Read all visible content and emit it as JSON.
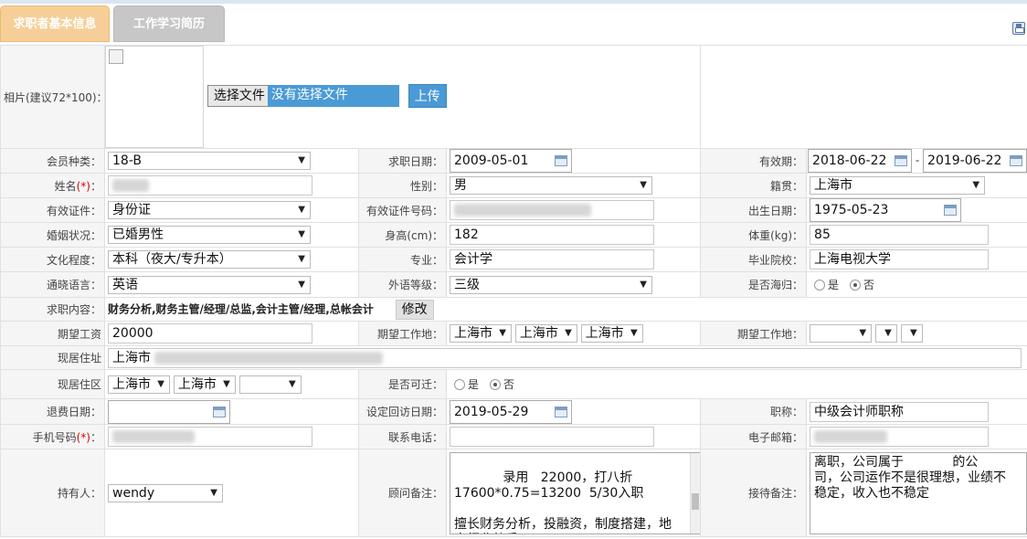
{
  "tabs": [
    {
      "label": "求职者基本信息"
    },
    {
      "label": "工作学习简历"
    }
  ],
  "photo": {
    "label": "相片(建议72*100)：",
    "file_button": "选择文件",
    "file_text": "没有选择文件",
    "upload_button": "上传"
  },
  "member_type": {
    "label": "会员种类：",
    "value": "18-B"
  },
  "apply_date": {
    "label": "求职日期：",
    "value": "2009-05-01"
  },
  "valid_period": {
    "label": "有效期：",
    "start": "2018-06-22",
    "sep": "-",
    "end": "2019-06-22"
  },
  "name": {
    "label": "姓名",
    "req": "(*)",
    "colon": "："
  },
  "gender": {
    "label": "性别：",
    "value": "男"
  },
  "native": {
    "label": "籍贯：",
    "value": "上海市"
  },
  "id_type": {
    "label": "有效证件：",
    "value": "身份证"
  },
  "id_number": {
    "label": "有效证件号码："
  },
  "birth": {
    "label": "出生日期：",
    "value": "1975-05-23"
  },
  "marital": {
    "label": "婚姻状况：",
    "value": "已婚男性"
  },
  "height": {
    "label": "身高(cm)：",
    "value": "182"
  },
  "weight": {
    "label": "体重(kg)：",
    "value": "85"
  },
  "education": {
    "label": "文化程度：",
    "value": "本科（夜大/专升本）"
  },
  "major": {
    "label": "专业：",
    "value": "会计学"
  },
  "school": {
    "label": "毕业院校：",
    "value": "上海电视大学"
  },
  "language": {
    "label": "通晓语言：",
    "value": "英语"
  },
  "lang_level": {
    "label": "外语等级：",
    "value": "三级"
  },
  "returnee": {
    "label": "是否海归：",
    "yes": "是",
    "no": "否"
  },
  "job_content": {
    "label": "求职内容：",
    "value": "财务分析,财务主管/经理/总监,会计主管/经理,总帐会计",
    "edit_button": "修改"
  },
  "salary": {
    "label": "期望工资",
    "value": "20000"
  },
  "work_place1": {
    "label": "期望工作地：",
    "v1": "上海市",
    "v2": "上海市",
    "v3": "上海市"
  },
  "work_place2": {
    "label": "期望工作地："
  },
  "address": {
    "label": "现居住址",
    "value": "上海市"
  },
  "district": {
    "label": "现居住区",
    "v1": "上海市",
    "v2": "上海市"
  },
  "relocate": {
    "label": "是否可迁：",
    "yes": "是",
    "no": "否"
  },
  "refund_date": {
    "label": "退费日期："
  },
  "revisit_date": {
    "label": "设定回访日期：",
    "value": "2019-05-29"
  },
  "title": {
    "label": "职称：",
    "value": "中级会计师职称"
  },
  "mobile": {
    "label": "手机号码",
    "req": "(*)",
    "colon": "："
  },
  "phone": {
    "label": "联系电话："
  },
  "email": {
    "label": "电子邮箱："
  },
  "owner": {
    "label": "持有人：",
    "value": "wendy"
  },
  "consultant_note": {
    "label": "顾问备注：",
    "value": "    录用   22000，打八折\n17600*0.75=13200  5/30入职\n\n擅长财务分析，投融资，制度搭建，地\n产行业熟悉"
  },
  "receiver_note": {
    "label": "接待备注：",
    "value": "离职，公司属于            的公\n司，公司运作不是很理想，业绩不\n稳定，收入也不稳定"
  }
}
